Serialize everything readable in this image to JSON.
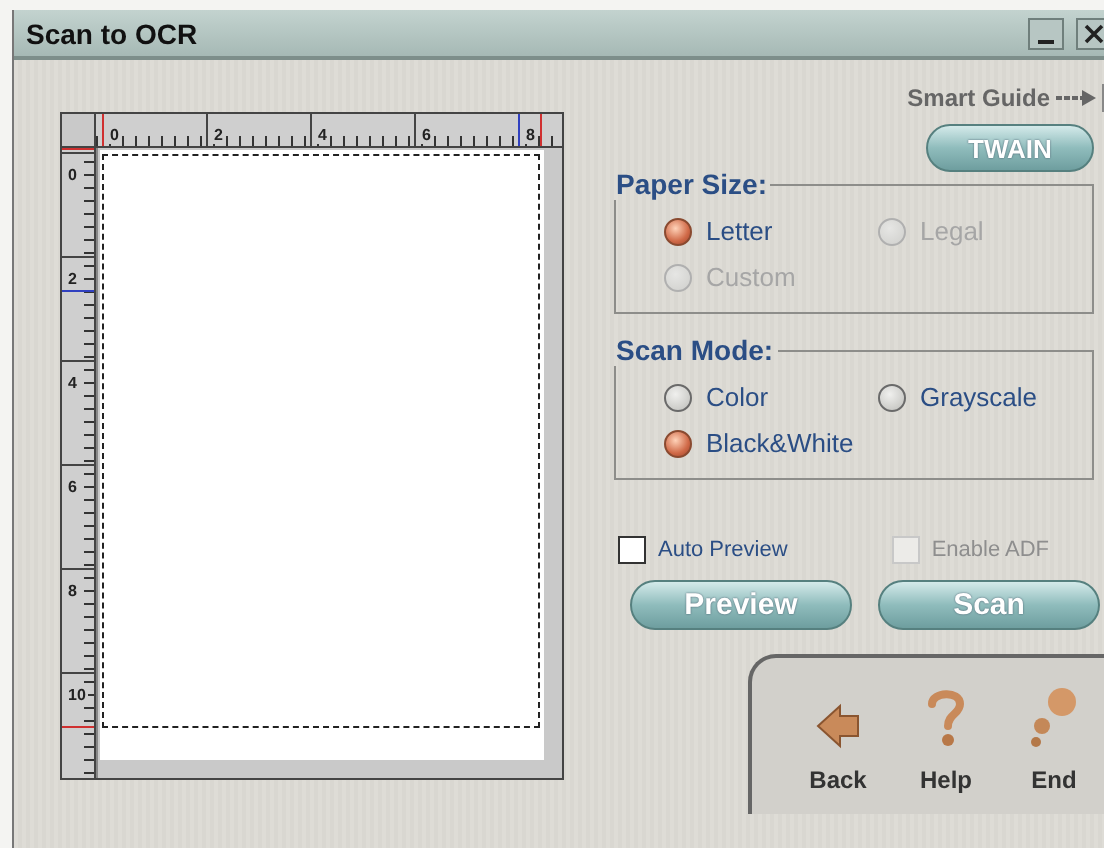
{
  "window": {
    "title": "Scan to OCR"
  },
  "smart_guide": {
    "label": "Smart Guide"
  },
  "twain_button": "TWAIN",
  "preview": {
    "top_ruler": [
      "0",
      "2",
      "4",
      "6",
      "8"
    ],
    "left_ruler": [
      "0",
      "2",
      "4",
      "6",
      "8",
      "10"
    ]
  },
  "paper_size": {
    "title": "Paper Size:",
    "options": [
      {
        "label": "Letter",
        "selected": true,
        "disabled": false
      },
      {
        "label": "Legal",
        "selected": false,
        "disabled": true
      },
      {
        "label": "Custom",
        "selected": false,
        "disabled": true
      }
    ]
  },
  "scan_mode": {
    "title": "Scan Mode:",
    "options": [
      {
        "label": "Color",
        "selected": false,
        "disabled": false
      },
      {
        "label": "Grayscale",
        "selected": false,
        "disabled": false
      },
      {
        "label": "Black&White",
        "selected": true,
        "disabled": false
      }
    ]
  },
  "checkboxes": [
    {
      "label": "Auto Preview",
      "checked": false,
      "disabled": false
    },
    {
      "label": "Enable ADF",
      "checked": false,
      "disabled": true
    }
  ],
  "buttons": [
    "Preview",
    "Scan"
  ],
  "nav": [
    {
      "label": "Back",
      "kind": "back"
    },
    {
      "label": "Help",
      "kind": "help"
    },
    {
      "label": "End",
      "kind": "end"
    }
  ]
}
